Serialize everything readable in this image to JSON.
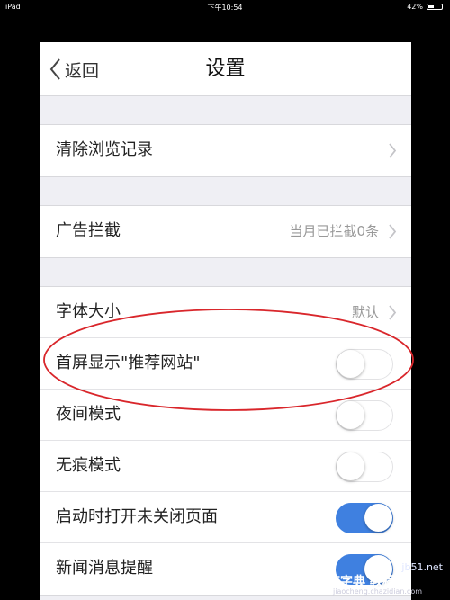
{
  "status_bar": {
    "device": "iPad",
    "time": "下午10:54",
    "battery": "42%",
    "battery_level": 0.42
  },
  "nav": {
    "back_label": "返回",
    "title": "设置"
  },
  "groups": {
    "g1": {
      "clear_history": "清除浏览记录"
    },
    "g2": {
      "ad_block": "广告拦截",
      "ad_block_value": "当月已拦截0条"
    },
    "g3": {
      "font_size": "字体大小",
      "font_size_value": "默认",
      "home_recommend": "首屏显示\"推荐网站\"",
      "home_recommend_on": false,
      "night_mode": "夜间模式",
      "night_mode_on": false,
      "incognito": "无痕模式",
      "incognito_on": false,
      "restore_pages": "启动时打开未关闭页面",
      "restore_pages_on": true,
      "news_alert": "新闻消息提醒",
      "news_alert_on": true
    }
  },
  "colors": {
    "toggle_on": "#3f80e0",
    "annotation": "#d9262b"
  },
  "watermark": {
    "site": "jb51.net",
    "brand": "查字典 教程网",
    "url": "jiaocheng.chazidian.com"
  }
}
